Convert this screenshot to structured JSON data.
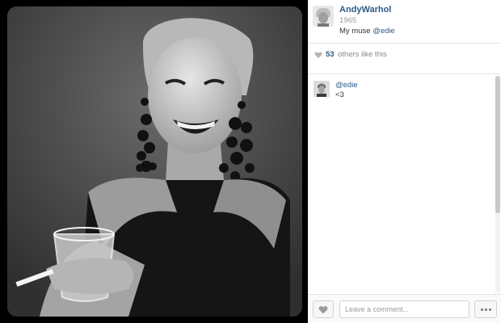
{
  "author": {
    "name": "AndyWarhol",
    "caption_year": "1965",
    "caption_text": "My muse ",
    "caption_mention": "@edie"
  },
  "likes": {
    "count": "53",
    "text": "others like this"
  },
  "comments": [
    {
      "user": "@edie",
      "text": "<3"
    }
  ],
  "footer": {
    "comment_placeholder": "Leave a comment..."
  },
  "colors": {
    "link": "#2c5a85",
    "muted": "#9a9a9a"
  },
  "icons": {
    "like": "heart-icon",
    "more": "ellipsis-icon"
  }
}
